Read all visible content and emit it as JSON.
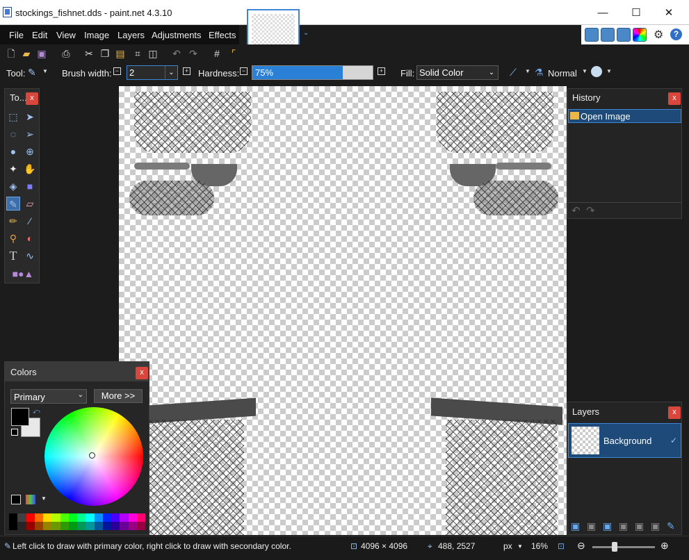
{
  "window": {
    "title": "stockings_fishnet.dds - paint.net 4.3.10",
    "min": "—",
    "max": "☐",
    "close": "✕"
  },
  "menu": {
    "items": [
      "File",
      "Edit",
      "View",
      "Image",
      "Layers",
      "Adjustments",
      "Effects"
    ]
  },
  "toolbar": {
    "tool_label": "Tool:",
    "brush_width_label": "Brush width:",
    "brush_width_value": "2",
    "hardness_label": "Hardness:",
    "hardness_value": "75%",
    "hardness_level": 0.75,
    "fill_label": "Fill:",
    "fill_value": "Solid Color",
    "blend_value": "Normal"
  },
  "tools_panel": {
    "title": "To...",
    "close": "x"
  },
  "colors_panel": {
    "title": "Colors",
    "close": "x",
    "select_value": "Primary",
    "more_button": "More >>",
    "palette": [
      "#000000",
      "#404040",
      "#ff0000",
      "#ff6a00",
      "#ffd800",
      "#b6ff00",
      "#4cff00",
      "#00ff21",
      "#00ff90",
      "#00ffff",
      "#0094ff",
      "#0026ff",
      "#4800ff",
      "#b200ff",
      "#ff00dc",
      "#ff006e"
    ]
  },
  "history_panel": {
    "title": "History",
    "close": "x",
    "items": [
      "Open Image"
    ]
  },
  "layers_panel": {
    "title": "Layers",
    "close": "x",
    "items": [
      "Background"
    ]
  },
  "status": {
    "hint": "Left click to draw with primary color, right click to draw with secondary color.",
    "image_size": "4096 × 4096",
    "cursor_pos": "488, 2527",
    "units": "px",
    "zoom": "16%"
  },
  "colors": {
    "accent": "#3d86d6",
    "close": "#d9463c",
    "selection": "#1d4a78"
  }
}
